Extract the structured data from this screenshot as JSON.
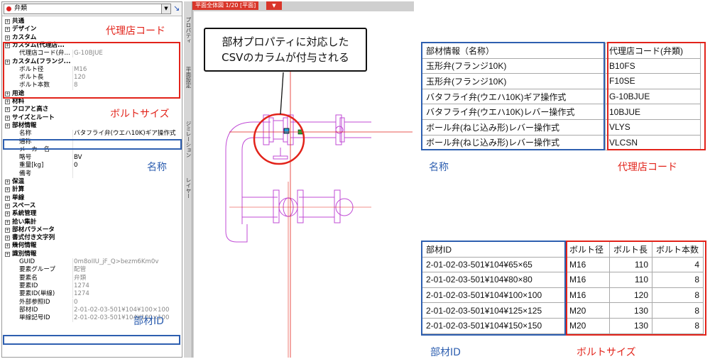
{
  "panel": {
    "selector": "弁類",
    "rows": [
      {
        "type": "cat",
        "label": "共通"
      },
      {
        "type": "cat",
        "label": "デザイン"
      },
      {
        "type": "cat",
        "label": "カスタム"
      },
      {
        "type": "cat",
        "label": "カスタム(代理店..."
      },
      {
        "type": "prop",
        "label": "代理店コード(弁...",
        "value": "G-10BJUE",
        "gray": true
      },
      {
        "type": "cat",
        "label": "カスタム(フランジ..."
      },
      {
        "type": "prop",
        "label": "ボルト径",
        "value": "M16",
        "gray": true
      },
      {
        "type": "prop",
        "label": "ボルト長",
        "value": "120",
        "gray": true
      },
      {
        "type": "prop",
        "label": "ボルト本数",
        "value": "8",
        "gray": true
      },
      {
        "type": "cat",
        "label": "用途"
      },
      {
        "type": "cat",
        "label": "材料"
      },
      {
        "type": "cat",
        "label": "フロアと高さ"
      },
      {
        "type": "cat",
        "label": "サイズとルート"
      },
      {
        "type": "cat",
        "label": "部材情報"
      },
      {
        "type": "prop",
        "label": "名称",
        "value": "バタフライ弁(ウエハ10K)ギア操作式",
        "gray": false
      },
      {
        "type": "prop",
        "label": "通称",
        "value": "",
        "gray": false
      },
      {
        "type": "prop",
        "label": "メーカー名",
        "value": "",
        "gray": false
      },
      {
        "type": "prop",
        "label": "略号",
        "value": "BV",
        "gray": false
      },
      {
        "type": "prop",
        "label": "重量[kg]",
        "value": "0",
        "gray": false
      },
      {
        "type": "prop",
        "label": "備考",
        "value": "",
        "gray": false
      },
      {
        "type": "cat",
        "label": "保温"
      },
      {
        "type": "cat",
        "label": "計算"
      },
      {
        "type": "cat",
        "label": "単線"
      },
      {
        "type": "cat",
        "label": "スペース"
      },
      {
        "type": "cat",
        "label": "系統管理"
      },
      {
        "type": "cat",
        "label": "拾い集計"
      },
      {
        "type": "cat",
        "label": "部材パラメータ"
      },
      {
        "type": "cat",
        "label": "書式付き文字列"
      },
      {
        "type": "cat",
        "label": "幾何情報"
      },
      {
        "type": "cat",
        "label": "識別情報"
      },
      {
        "type": "prop",
        "label": "GUID",
        "value": "0m8oIIU_jF_Q>bezm6Km0v",
        "gray": true
      },
      {
        "type": "prop",
        "label": "要素グループ",
        "value": "配管",
        "gray": true
      },
      {
        "type": "prop",
        "label": "要素名",
        "value": "弁類",
        "gray": true
      },
      {
        "type": "prop",
        "label": "要素ID",
        "value": "1274",
        "gray": true
      },
      {
        "type": "prop",
        "label": "要素ID(単線)",
        "value": "1274",
        "gray": true
      },
      {
        "type": "prop",
        "label": "外部参照ID",
        "value": "0",
        "gray": true
      },
      {
        "type": "prop",
        "label": "部材ID",
        "value": "2-01-02-03-501¥104¥100×100",
        "gray": true
      },
      {
        "type": "prop",
        "label": "単線記号ID",
        "value": "2-01-02-03-501¥104¥100×100",
        "gray": true
      }
    ]
  },
  "cad": {
    "view_title": "平面全体図 1/20 [平面]",
    "tabs": [
      "プロパティ",
      "平面設定",
      "ジミレーション",
      "レイヤー"
    ],
    "callout_line1": "部材プロパティに対応した",
    "callout_line2": "CSVのカラムが付与される"
  },
  "annotations": {
    "agency_code": "代理店コード",
    "bolt_size": "ボルトサイズ",
    "name": "名称",
    "part_id": "部材ID"
  },
  "table_name": {
    "headers": [
      "部材情報（名称）",
      "代理店コード(弁類)"
    ],
    "rows": [
      [
        "玉形弁(フランジ10K)",
        "B10FS"
      ],
      [
        "玉形弁(フランジ10K)",
        "F10SE"
      ],
      [
        "バタフライ弁(ウエハ10K)ギア操作式",
        "G-10BJUE"
      ],
      [
        "バタフライ弁(ウエハ10K)レバー操作式",
        "10BJUE"
      ],
      [
        "ボール弁(ねじ込み形)レバー操作式",
        "VLYS"
      ],
      [
        "ボール弁(ねじ込み形)レバー操作式",
        "VLCSN"
      ]
    ]
  },
  "table_bolt": {
    "headers": [
      "部材ID",
      "ボルト径",
      "ボルト長",
      "ボルト本数"
    ],
    "rows": [
      [
        "2-01-02-03-501¥104¥65×65",
        "M16",
        "110",
        "4"
      ],
      [
        "2-01-02-03-501¥104¥80×80",
        "M16",
        "110",
        "8"
      ],
      [
        "2-01-02-03-501¥104¥100×100",
        "M16",
        "120",
        "8"
      ],
      [
        "2-01-02-03-501¥104¥125×125",
        "M20",
        "130",
        "8"
      ],
      [
        "2-01-02-03-501¥104¥150×150",
        "M20",
        "130",
        "8"
      ]
    ]
  },
  "colors": {
    "red": "#e2231a",
    "blue": "#2e5fb0",
    "pipe": "#c04bd6"
  }
}
